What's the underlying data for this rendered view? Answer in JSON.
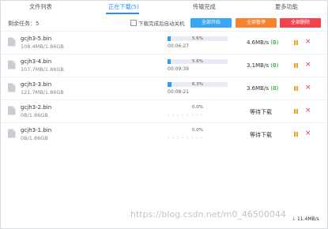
{
  "tabs": {
    "file_list": "文件列表",
    "downloading": "正在下载(5)",
    "completed": "传输完成",
    "more": "更多功能"
  },
  "toolbar": {
    "task_count": "剩余任务：5",
    "auto_shutdown": "下载完成后自动关机",
    "start_all": "全部开始",
    "pause_all": "全部暂停",
    "delete_all": "全部删除"
  },
  "tasks": [
    {
      "name": "gcjh3-5.bin",
      "size": "108.4MB/1.86GB",
      "percent": "5.6%",
      "progress": 0.056,
      "time": "00:06:27",
      "speed": "4.6MB/s",
      "speed_b": "(B)"
    },
    {
      "name": "gcjh3-4.bin",
      "size": "107.7MB/1.86GB",
      "percent": "5.6%",
      "progress": 0.056,
      "time": "00:09:39",
      "speed": "3.1MB/s",
      "speed_b": "(B)"
    },
    {
      "name": "gcjh3-3.bin",
      "size": "121.7MB/1.86GB",
      "percent": "6.3%",
      "progress": 0.063,
      "time": "00:08:21",
      "speed": "3.6MB/s",
      "speed_b": "(B)"
    },
    {
      "name": "gcjh3-2.bin",
      "size": "0B/1.86GB",
      "percent": "0.0%",
      "progress": 0.0,
      "time": "- - : - - : - -",
      "status": "等待下载"
    },
    {
      "name": "gcjh3-1.bin",
      "size": "0B/1.86GB",
      "percent": "0.0%",
      "progress": 0.0,
      "time": "- - : - - : - -",
      "status": "等待下载"
    }
  ],
  "footer": {
    "watermark": "https://blog.csdn.net/m0_46500044",
    "arrow": "↓",
    "total_speed": "11.4MB/s"
  },
  "colors": {
    "accent": "#2c8ef8",
    "start": "#35a7f5",
    "pause": "#f8822d",
    "delete": "#f2434f"
  }
}
